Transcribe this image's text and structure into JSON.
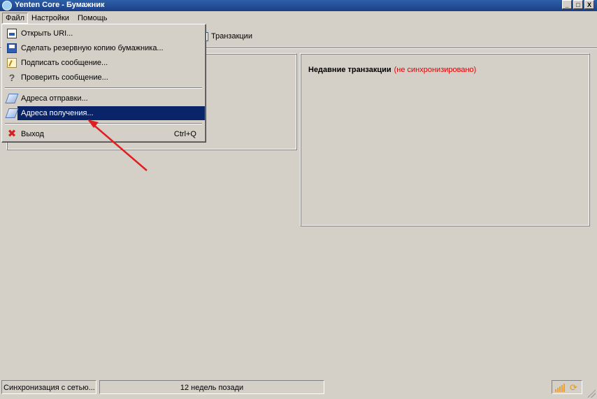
{
  "window": {
    "title": "Yenten Core - Бумажник",
    "buttons": [
      "_",
      "□",
      "X"
    ]
  },
  "menubar": {
    "items": [
      {
        "label": "Файл",
        "open": true
      },
      {
        "label": "Настройки"
      },
      {
        "label": "Помощь"
      }
    ]
  },
  "toolbar": {
    "transactions_label": "Транзакции"
  },
  "file_menu": {
    "items": [
      {
        "label": "Открыть URI...",
        "icon": "open-uri-icon"
      },
      {
        "label": "Сделать резервную копию бумажника...",
        "icon": "save-icon"
      },
      {
        "label": "Подписать сообщение...",
        "icon": "sign-message-icon"
      },
      {
        "label": "Проверить сообщение...",
        "icon": "verify-message-icon"
      },
      {
        "label": "Адреса отправки...",
        "icon": "address-book-icon"
      },
      {
        "label": "Адреса получения...",
        "icon": "address-book-icon",
        "highlighted": true
      },
      {
        "label": "Выход",
        "shortcut": "Ctrl+Q",
        "icon": "exit-icon"
      }
    ]
  },
  "recent": {
    "title": "Недавние транзакции",
    "status": "(не синхронизировано)",
    "status_color": "#e00000"
  },
  "statusbar": {
    "sync_text": "Синхронизация с сетью...",
    "progress_text": "12 недель позади"
  },
  "colors": {
    "highlight": "#0a246a",
    "annotation_arrow": "#e02020"
  }
}
